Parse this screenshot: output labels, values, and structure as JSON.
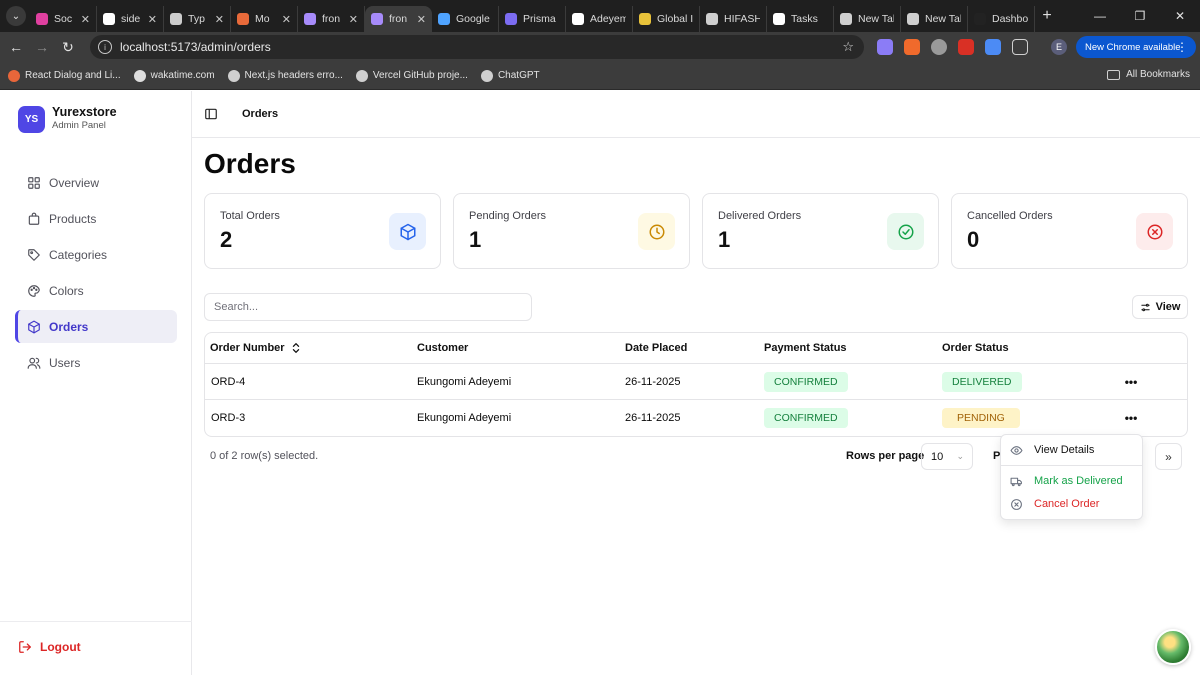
{
  "browser": {
    "tabs": [
      {
        "title": "Soc",
        "color": "#e040a0",
        "active": false
      },
      {
        "title": "side",
        "color": "#ffffff",
        "active": false
      },
      {
        "title": "Typ",
        "color": "#cccccc",
        "active": false
      },
      {
        "title": "Mo",
        "color": "#e86a3a",
        "active": false
      },
      {
        "title": "fron",
        "color": "#a78bfa",
        "active": false
      },
      {
        "title": "fron",
        "color": "#a78bfa",
        "active": true
      },
      {
        "title": "Google",
        "color": "#4fa3ff",
        "active": false
      },
      {
        "title": "Prisma",
        "color": "#7c6cf2",
        "active": false
      },
      {
        "title": "Adeyem",
        "color": "#ffffff",
        "active": false
      },
      {
        "title": "Global I",
        "color": "#e8c23a",
        "active": false
      },
      {
        "title": "HIFASHI",
        "color": "#cfcfcf",
        "active": false
      },
      {
        "title": "Tasks",
        "color": "#ffffff",
        "active": false
      },
      {
        "title": "New Tal",
        "color": "#cfcfcf",
        "active": false
      },
      {
        "title": "New Tal",
        "color": "#cfcfcf",
        "active": false
      },
      {
        "title": "Dashbo",
        "color": "#222222",
        "active": false
      }
    ],
    "url": "localhost:5173/admin/orders",
    "new_chrome_label": "New Chrome available",
    "profile_initial": "E",
    "bookmarks": [
      {
        "label": "React Dialog and Li...",
        "color": "#e8663a"
      },
      {
        "label": "wakatime.com",
        "color": "#dddddd"
      },
      {
        "label": "Next.js headers erro...",
        "color": "#cfcfcf"
      },
      {
        "label": "Vercel GitHub proje...",
        "color": "#cfcfcf"
      },
      {
        "label": "ChatGPT",
        "color": "#cfcfcf"
      }
    ],
    "all_bookmarks_label": "All Bookmarks"
  },
  "sidebar": {
    "brand_initials": "YS",
    "brand_name": "Yurexstore",
    "brand_sub": "Admin Panel",
    "items": [
      {
        "label": "Overview",
        "icon": "grid-icon",
        "active": false
      },
      {
        "label": "Products",
        "icon": "bag-icon",
        "active": false
      },
      {
        "label": "Categories",
        "icon": "tag-icon",
        "active": false
      },
      {
        "label": "Colors",
        "icon": "palette-icon",
        "active": false
      },
      {
        "label": "Orders",
        "icon": "box-icon",
        "active": true
      },
      {
        "label": "Users",
        "icon": "users-icon",
        "active": false
      }
    ],
    "logout_label": "Logout"
  },
  "topbar": {
    "breadcrumb": "Orders"
  },
  "page": {
    "title": "Orders"
  },
  "stats": [
    {
      "label": "Total Orders",
      "value": "2",
      "icon": "box-icon",
      "icon_bg": "#e8f0fe",
      "icon_color": "#2563eb"
    },
    {
      "label": "Pending Orders",
      "value": "1",
      "icon": "clock-icon",
      "icon_bg": "#fef9e3",
      "icon_color": "#ca8a04"
    },
    {
      "label": "Delivered Orders",
      "value": "1",
      "icon": "check-circle-icon",
      "icon_bg": "#e8f8ee",
      "icon_color": "#16a34a"
    },
    {
      "label": "Cancelled Orders",
      "value": "0",
      "icon": "x-circle-icon",
      "icon_bg": "#fdecec",
      "icon_color": "#dc2626"
    }
  ],
  "search": {
    "placeholder": "Search..."
  },
  "view_button": "View",
  "table": {
    "headers": [
      "Order Number",
      "Customer",
      "Date Placed",
      "Payment Status",
      "Order Status"
    ],
    "rows": [
      {
        "order": "ORD-4",
        "customer": "Ekungomi Adeyemi",
        "date": "26-11-2025",
        "payment": "CONFIRMED",
        "status": "DELIVERED"
      },
      {
        "order": "ORD-3",
        "customer": "Ekungomi Adeyemi",
        "date": "26-11-2025",
        "payment": "CONFIRMED",
        "status": "PENDING"
      }
    ],
    "row_menu": "•••"
  },
  "pagination": {
    "selected_info": "0 of 2 row(s) selected.",
    "rows_per_page_label": "Rows per page",
    "rows_per_page_value": "10",
    "page_label": "P",
    "last_page": "»"
  },
  "row_actions_menu": {
    "view": "View Details",
    "deliver": "Mark as Delivered",
    "cancel": "Cancel Order"
  }
}
